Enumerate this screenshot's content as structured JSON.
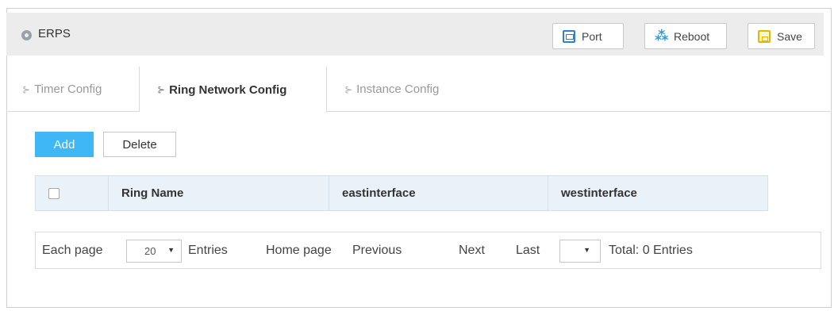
{
  "header": {
    "title": "ERPS",
    "buttons": {
      "port": "Port",
      "reboot": "Reboot",
      "save": "Save"
    }
  },
  "tabs": [
    {
      "label": "Timer Config",
      "active": false
    },
    {
      "label": "Ring Network Config",
      "active": true
    },
    {
      "label": "Instance Config",
      "active": false
    }
  ],
  "actions": {
    "add": "Add",
    "delete": "Delete"
  },
  "table": {
    "columns": [
      "Ring Name",
      "eastinterface",
      "westinterface"
    ],
    "rows": []
  },
  "pagination": {
    "each_page": "Each page",
    "page_size": "20",
    "entries": "Entries",
    "home": "Home page",
    "previous": "Previous",
    "next": "Next",
    "last": "Last",
    "page_select": "",
    "total": "Total: 0 Entries"
  },
  "colors": {
    "accent": "#3fb6f5",
    "header_bg": "#ececec",
    "table_head_bg": "#e9f2f8"
  }
}
